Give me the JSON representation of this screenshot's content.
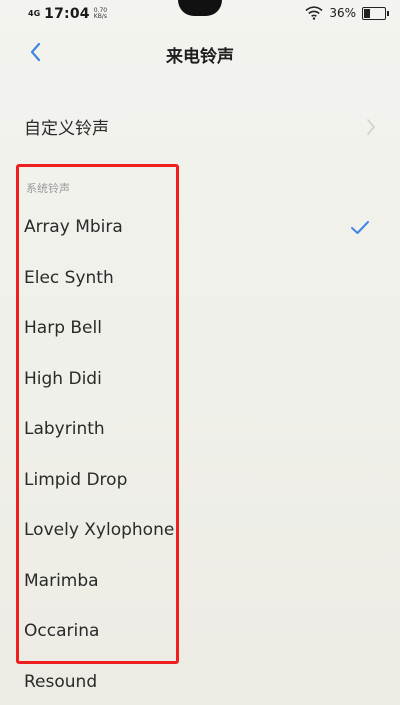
{
  "status_bar": {
    "network": "4G",
    "time": "17:04",
    "speed_value": "0.70",
    "speed_unit": "KB/s",
    "battery_percent": "36%",
    "battery_level": 0.36
  },
  "header": {
    "title": "来电铃声"
  },
  "custom_ringtone": {
    "label": "自定义铃声"
  },
  "system_section": {
    "header": "系统铃声",
    "items": [
      {
        "name": "Array Mbira",
        "selected": true
      },
      {
        "name": "Elec Synth",
        "selected": false
      },
      {
        "name": "Harp Bell",
        "selected": false
      },
      {
        "name": "High Didi",
        "selected": false
      },
      {
        "name": "Labyrinth",
        "selected": false
      },
      {
        "name": "Limpid Drop",
        "selected": false
      },
      {
        "name": "Lovely Xylophone",
        "selected": false
      },
      {
        "name": "Marimba",
        "selected": false
      },
      {
        "name": "Occarina",
        "selected": false
      },
      {
        "name": "Resound",
        "selected": false
      }
    ]
  },
  "colors": {
    "accent": "#3f86e0",
    "highlight": "#ee1f1f"
  }
}
